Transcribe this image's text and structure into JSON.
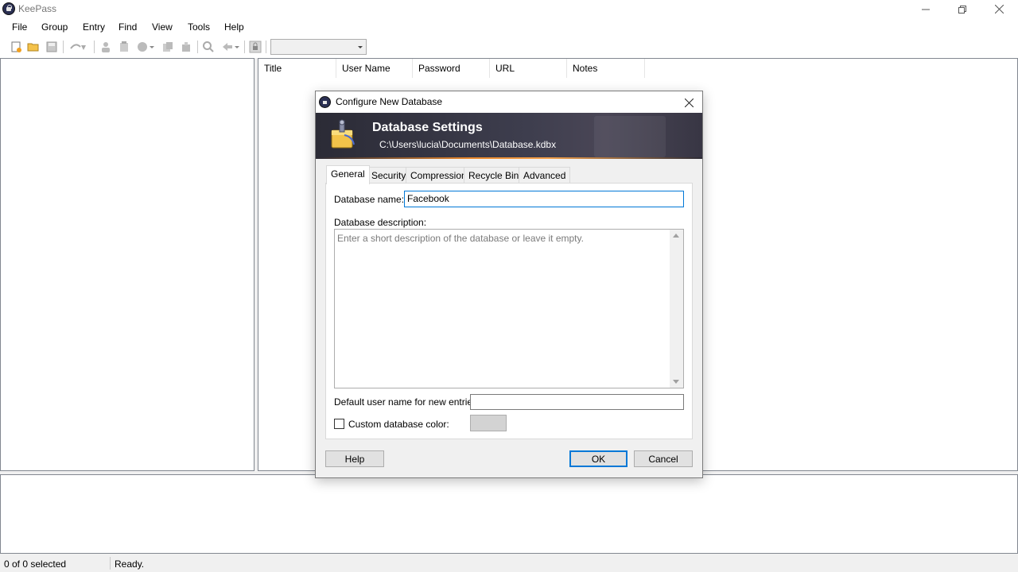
{
  "window": {
    "title": "KeePass"
  },
  "menu": [
    "File",
    "Group",
    "Entry",
    "Find",
    "View",
    "Tools",
    "Help"
  ],
  "toolbar": {
    "icons": [
      "new-database-icon",
      "open-database-icon",
      "save-icon",
      "sync-icon",
      "add-entry-icon",
      "edit-entry-icon",
      "entry-dropdown-icon",
      "copy-username-icon",
      "copy-password-icon",
      "find-icon",
      "autotype-icon",
      "lock-icon"
    ],
    "quick_find_value": ""
  },
  "entry_list": {
    "columns": [
      "Title",
      "User Name",
      "Password",
      "URL",
      "Notes"
    ]
  },
  "status": {
    "count": "0 of 0 selected",
    "text": "Ready."
  },
  "dialog": {
    "title": "Configure New Database",
    "banner_title": "Database Settings",
    "banner_path": "C:\\Users\\lucia\\Documents\\Database.kdbx",
    "tabs": [
      "General",
      "Security",
      "Compression",
      "Recycle Bin",
      "Advanced"
    ],
    "active_tab": "General",
    "name_label": "Database name:",
    "name_value": "Facebook",
    "description_label": "Database description:",
    "description_placeholder": "Enter a short description of the database or leave it empty.",
    "default_user_label": "Default user name for new entries:",
    "default_user_value": "",
    "custom_color_label": "Custom database color:",
    "custom_color_checked": false,
    "swatch_color": "#d3d3d3",
    "buttons": {
      "help": "Help",
      "ok": "OK",
      "cancel": "Cancel"
    }
  },
  "colors": {
    "accent": "#0078d7",
    "banner": "#2b2b36"
  }
}
